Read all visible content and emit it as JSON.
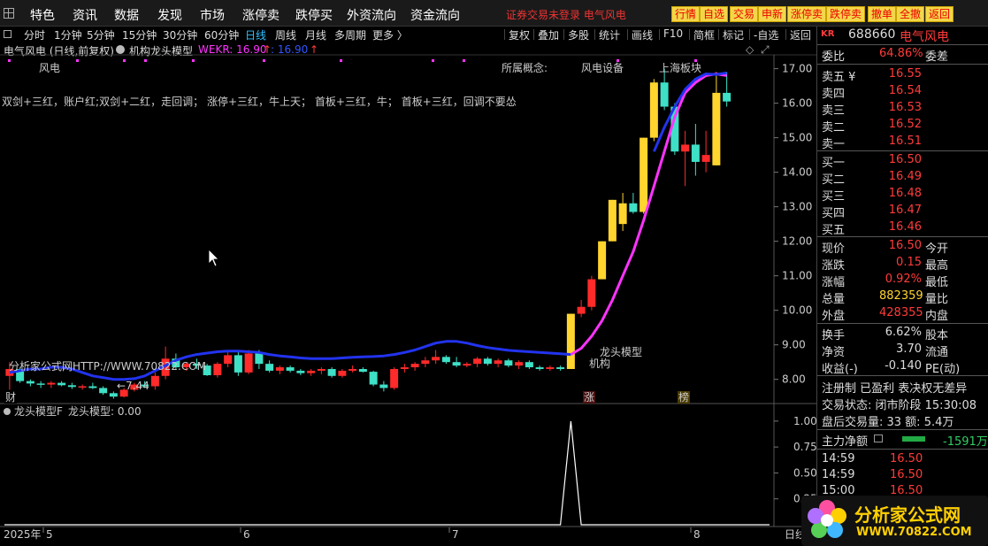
{
  "menu": {
    "items": [
      "特色",
      "资讯",
      "数据",
      "发现",
      "市场",
      "涨停卖",
      "跌停买",
      "外资流向",
      "资金流向"
    ],
    "login_status": "证券交易未登录  电气风电",
    "buttons": [
      "行情",
      "自选",
      "交易",
      "申新",
      "涨停卖",
      "跌停卖",
      "撤单",
      "全撤",
      "返回"
    ]
  },
  "toolbar": {
    "periods": [
      "分时",
      "1分钟",
      "5分钟",
      "15分钟",
      "30分钟",
      "60分钟",
      "日线",
      "周线",
      "月线",
      "多周期",
      "更多 〉"
    ],
    "active_period": "日线",
    "tools": [
      "复权",
      "叠加",
      "多股",
      "统计",
      "画线",
      "F10",
      "简框",
      "标记",
      "-自选",
      "返回"
    ]
  },
  "chart_info": {
    "title": "电气风电 (日线,前复权)",
    "indicator": "机构龙头模型",
    "wekr_label": "WEKR: 16.90",
    "wekr_arrow": "↑",
    "second_value": ": 16.90",
    "second_arrow": "↑"
  },
  "annotations": {
    "tag_fengdian": "风电",
    "concept_label": "所属概念:",
    "concept_value": "风电设备",
    "board_label": "上海板块",
    "strategy_text": "双剑+三红，账户红;双剑+二红，走回调；  涨停+三红，牛上天；  首板+三红，牛；  首板+三红，回调不要怂",
    "dragon_model": "龙头模型",
    "institution": "机构",
    "low_marker": "←7.44",
    "watermark_url": "分析家公式网HTTP://WWW.70822.COM",
    "cai_marker": "财",
    "zhang_marker": "涨",
    "bang_marker": "榜"
  },
  "sub_chart": {
    "title": "龙头模型F",
    "value_label": "龙头模型: 0.00"
  },
  "chart_data": [
    {
      "type": "candlestick",
      "title": "电气风电 (日线,前复权)",
      "yaxis_ticks": [
        17.0,
        16.0,
        15.0,
        14.0,
        13.0,
        12.0,
        11.0,
        10.0,
        9.0,
        8.0
      ],
      "xaxis_labels": [
        "2025年",
        "5",
        "6",
        "7",
        "8",
        "日线"
      ],
      "ylim": [
        7.3,
        17.4
      ],
      "candles": [
        {
          "o": 8.1,
          "h": 8.5,
          "l": 7.7,
          "c": 8.3
        },
        {
          "o": 8.3,
          "h": 8.35,
          "l": 7.9,
          "c": 7.95
        },
        {
          "o": 7.95,
          "h": 8.0,
          "l": 7.8,
          "c": 7.88
        },
        {
          "o": 7.88,
          "h": 7.95,
          "l": 7.75,
          "c": 7.85
        },
        {
          "o": 7.85,
          "h": 7.95,
          "l": 7.75,
          "c": 7.9
        },
        {
          "o": 7.9,
          "h": 7.95,
          "l": 7.8,
          "c": 7.83
        },
        {
          "o": 7.83,
          "h": 7.9,
          "l": 7.72,
          "c": 7.78
        },
        {
          "o": 7.78,
          "h": 7.85,
          "l": 7.7,
          "c": 7.8
        },
        {
          "o": 7.8,
          "h": 7.9,
          "l": 7.72,
          "c": 7.75
        },
        {
          "o": 7.75,
          "h": 7.8,
          "l": 7.55,
          "c": 7.6
        },
        {
          "o": 7.6,
          "h": 7.65,
          "l": 7.44,
          "c": 7.5
        },
        {
          "o": 7.5,
          "h": 7.75,
          "l": 7.48,
          "c": 7.7
        },
        {
          "o": 7.7,
          "h": 7.9,
          "l": 7.65,
          "c": 7.85
        },
        {
          "o": 7.85,
          "h": 7.95,
          "l": 7.75,
          "c": 7.8
        },
        {
          "o": 7.8,
          "h": 8.2,
          "l": 7.7,
          "c": 8.1
        },
        {
          "o": 8.1,
          "h": 8.95,
          "l": 8.0,
          "c": 8.6
        },
        {
          "o": 8.6,
          "h": 8.75,
          "l": 8.3,
          "c": 8.35
        },
        {
          "o": 8.35,
          "h": 8.5,
          "l": 8.25,
          "c": 8.45
        },
        {
          "o": 8.45,
          "h": 8.6,
          "l": 8.3,
          "c": 8.4
        },
        {
          "o": 8.4,
          "h": 8.45,
          "l": 8.1,
          "c": 8.12
        },
        {
          "o": 8.12,
          "h": 8.5,
          "l": 8.05,
          "c": 8.45
        },
        {
          "o": 8.45,
          "h": 8.8,
          "l": 8.35,
          "c": 8.7
        },
        {
          "o": 8.7,
          "h": 8.8,
          "l": 8.1,
          "c": 8.2
        },
        {
          "o": 8.2,
          "h": 8.85,
          "l": 8.15,
          "c": 8.75
        },
        {
          "o": 8.75,
          "h": 8.85,
          "l": 8.3,
          "c": 8.45
        },
        {
          "o": 8.45,
          "h": 8.55,
          "l": 8.2,
          "c": 8.25
        },
        {
          "o": 8.25,
          "h": 8.4,
          "l": 8.15,
          "c": 8.35
        },
        {
          "o": 8.35,
          "h": 8.4,
          "l": 8.2,
          "c": 8.25
        },
        {
          "o": 8.25,
          "h": 8.3,
          "l": 8.12,
          "c": 8.18
        },
        {
          "o": 8.18,
          "h": 8.3,
          "l": 8.1,
          "c": 8.25
        },
        {
          "o": 8.25,
          "h": 8.35,
          "l": 8.15,
          "c": 8.3
        },
        {
          "o": 8.3,
          "h": 8.35,
          "l": 8.05,
          "c": 8.1
        },
        {
          "o": 8.1,
          "h": 8.3,
          "l": 8.05,
          "c": 8.25
        },
        {
          "o": 8.25,
          "h": 8.4,
          "l": 8.2,
          "c": 8.3
        },
        {
          "o": 8.3,
          "h": 8.35,
          "l": 8.2,
          "c": 8.22
        },
        {
          "o": 8.22,
          "h": 8.25,
          "l": 7.8,
          "c": 7.85
        },
        {
          "o": 7.85,
          "h": 7.95,
          "l": 7.65,
          "c": 7.75
        },
        {
          "o": 7.75,
          "h": 8.35,
          "l": 7.7,
          "c": 8.3
        },
        {
          "o": 8.3,
          "h": 8.45,
          "l": 8.2,
          "c": 8.35
        },
        {
          "o": 8.35,
          "h": 8.5,
          "l": 8.25,
          "c": 8.45
        },
        {
          "o": 8.45,
          "h": 8.65,
          "l": 8.35,
          "c": 8.55
        },
        {
          "o": 8.55,
          "h": 8.85,
          "l": 8.45,
          "c": 8.65
        },
        {
          "o": 8.65,
          "h": 8.7,
          "l": 8.45,
          "c": 8.5
        },
        {
          "o": 8.5,
          "h": 8.65,
          "l": 8.35,
          "c": 8.4
        },
        {
          "o": 8.4,
          "h": 8.5,
          "l": 8.35,
          "c": 8.45
        },
        {
          "o": 8.45,
          "h": 8.65,
          "l": 8.35,
          "c": 8.6
        },
        {
          "o": 8.6,
          "h": 8.65,
          "l": 8.4,
          "c": 8.45
        },
        {
          "o": 8.45,
          "h": 8.6,
          "l": 8.35,
          "c": 8.55
        },
        {
          "o": 8.55,
          "h": 8.6,
          "l": 8.35,
          "c": 8.4
        },
        {
          "o": 8.4,
          "h": 8.55,
          "l": 8.3,
          "c": 8.5
        },
        {
          "o": 8.5,
          "h": 8.55,
          "l": 8.3,
          "c": 8.35
        },
        {
          "o": 8.35,
          "h": 8.4,
          "l": 8.25,
          "c": 8.3
        },
        {
          "o": 8.3,
          "h": 8.4,
          "l": 8.25,
          "c": 8.35
        },
        {
          "o": 8.35,
          "h": 8.4,
          "l": 8.25,
          "c": 8.3
        },
        {
          "o": 8.3,
          "h": 9.9,
          "l": 8.3,
          "c": 9.9
        },
        {
          "o": 9.9,
          "h": 10.3,
          "l": 9.8,
          "c": 10.1
        },
        {
          "o": 10.1,
          "h": 11.0,
          "l": 10.0,
          "c": 10.9
        },
        {
          "o": 10.9,
          "h": 12.0,
          "l": 10.9,
          "c": 12.0
        },
        {
          "o": 12.0,
          "h": 13.2,
          "l": 12.0,
          "c": 13.2
        },
        {
          "o": 12.5,
          "h": 13.4,
          "l": 12.3,
          "c": 13.1
        },
        {
          "o": 13.1,
          "h": 13.4,
          "l": 12.8,
          "c": 12.85
        },
        {
          "o": 12.85,
          "h": 15.0,
          "l": 12.8,
          "c": 15.0
        },
        {
          "o": 15.0,
          "h": 16.7,
          "l": 14.9,
          "c": 16.6
        },
        {
          "o": 16.6,
          "h": 17.0,
          "l": 15.8,
          "c": 15.9
        },
        {
          "o": 15.9,
          "h": 16.0,
          "l": 14.5,
          "c": 14.6
        },
        {
          "o": 14.6,
          "h": 15.2,
          "l": 13.6,
          "c": 14.8
        },
        {
          "o": 14.8,
          "h": 15.4,
          "l": 13.9,
          "c": 14.3
        },
        {
          "o": 14.3,
          "h": 15.2,
          "l": 14.0,
          "c": 14.5
        },
        {
          "o": 14.2,
          "h": 16.9,
          "l": 14.2,
          "c": 16.3
        },
        {
          "o": 16.3,
          "h": 16.9,
          "l": 15.9,
          "c": 16.05
        }
      ],
      "limit_up_indices": [
        54,
        57,
        58,
        59,
        61,
        62,
        68
      ],
      "blue_line_start": 0,
      "blue_line": [
        8.2,
        8.25,
        8.3,
        8.3,
        8.35,
        8.35,
        8.3,
        8.2,
        8.1,
        8.05,
        8.0,
        8.0,
        8.02,
        8.1,
        8.25,
        8.4,
        8.55,
        8.65,
        8.72,
        8.76,
        8.8,
        8.82,
        8.82,
        8.8,
        8.78,
        8.72,
        8.68,
        8.65,
        8.62,
        8.6,
        8.6,
        8.6,
        8.62,
        8.64,
        8.65,
        8.66,
        8.68,
        8.72,
        8.78,
        8.85,
        8.95,
        9.05,
        9.1,
        9.1,
        9.05,
        8.98,
        8.92,
        8.88,
        8.84,
        8.82,
        8.8,
        8.78,
        8.76,
        8.74,
        8.72
      ],
      "pink_line_start": 54,
      "pink_line": [
        8.72,
        8.9,
        9.25,
        9.7,
        10.3,
        11.0,
        11.7,
        12.6,
        13.6,
        14.6,
        15.6,
        16.3,
        16.6,
        16.8,
        16.85,
        16.8
      ],
      "blue_line2_start": 62,
      "blue_line2": [
        14.6,
        15.3,
        15.9,
        16.4,
        16.7,
        16.85,
        16.83,
        16.88
      ]
    },
    {
      "type": "line",
      "title": "龙头模型F",
      "yaxis_ticks": [
        1.0,
        0.75,
        0.5,
        0.25
      ],
      "ylim": [
        0,
        1.05
      ],
      "values": "zero except one spike to 1.0 at index 54"
    }
  ],
  "quote": {
    "badge": "KR",
    "code": "688660",
    "name": "电气风电",
    "weibi_label": "委比",
    "weibi_value": "64.86%",
    "weicha_label": "委差",
    "asks": [
      {
        "label": "卖五 ¥",
        "price": "16.55"
      },
      {
        "label": "卖四",
        "price": "16.54"
      },
      {
        "label": "卖三",
        "price": "16.53"
      },
      {
        "label": "卖二",
        "price": "16.52"
      },
      {
        "label": "卖一",
        "price": "16.51"
      }
    ],
    "bids": [
      {
        "label": "买一",
        "price": "16.50"
      },
      {
        "label": "买二",
        "price": "16.49"
      },
      {
        "label": "买三",
        "price": "16.48"
      },
      {
        "label": "买四",
        "price": "16.47"
      },
      {
        "label": "买五",
        "price": "16.46"
      }
    ],
    "stats": [
      {
        "label": "现价",
        "value": "16.50",
        "color": "#ff3b3b",
        "label2": "今开"
      },
      {
        "label": "涨跌",
        "value": "0.15",
        "color": "#ff3b3b",
        "label2": "最高"
      },
      {
        "label": "涨幅",
        "value": "0.92%",
        "color": "#ff3b3b",
        "label2": "最低"
      },
      {
        "label": "总量",
        "value": "882359",
        "color": "#ffd52e",
        "label2": "量比"
      },
      {
        "label": "外盘",
        "value": "428355",
        "color": "#ff3b3b",
        "label2": "内盘"
      }
    ],
    "stats2": [
      {
        "label": "换手",
        "value": "6.62%",
        "color": "#dddddd",
        "label2": "股本"
      },
      {
        "label": "净资",
        "value": "3.70",
        "color": "#dddddd",
        "label2": "流通"
      },
      {
        "label": "收益(-)",
        "value": "-0.140",
        "color": "#dddddd",
        "label2": "PE(动)"
      }
    ],
    "status": "注册制 已盈利 表决权无差异",
    "trade_state": "交易状态: 闭市阶段 15:30:08",
    "after_hours": "盘后交易量: 33  额: 5.4万",
    "main_flow_label": "主力净额",
    "main_flow_value": "-1591万",
    "ticks": [
      {
        "time": "14:59",
        "price": "16.50"
      },
      {
        "time": "14:59",
        "price": "16.50"
      },
      {
        "time": "15:00",
        "price": "16.50"
      }
    ]
  },
  "logo": {
    "text": "分析家公式网",
    "url": "WWW.70822.COM"
  },
  "colors": {
    "up": "#ff2a2a",
    "down": "#3ee0c6",
    "limit_up": "#ffd52e",
    "ma_blue": "#2233ee",
    "ma_pink": "#ff33ff",
    "accent": "#31c0ff"
  }
}
